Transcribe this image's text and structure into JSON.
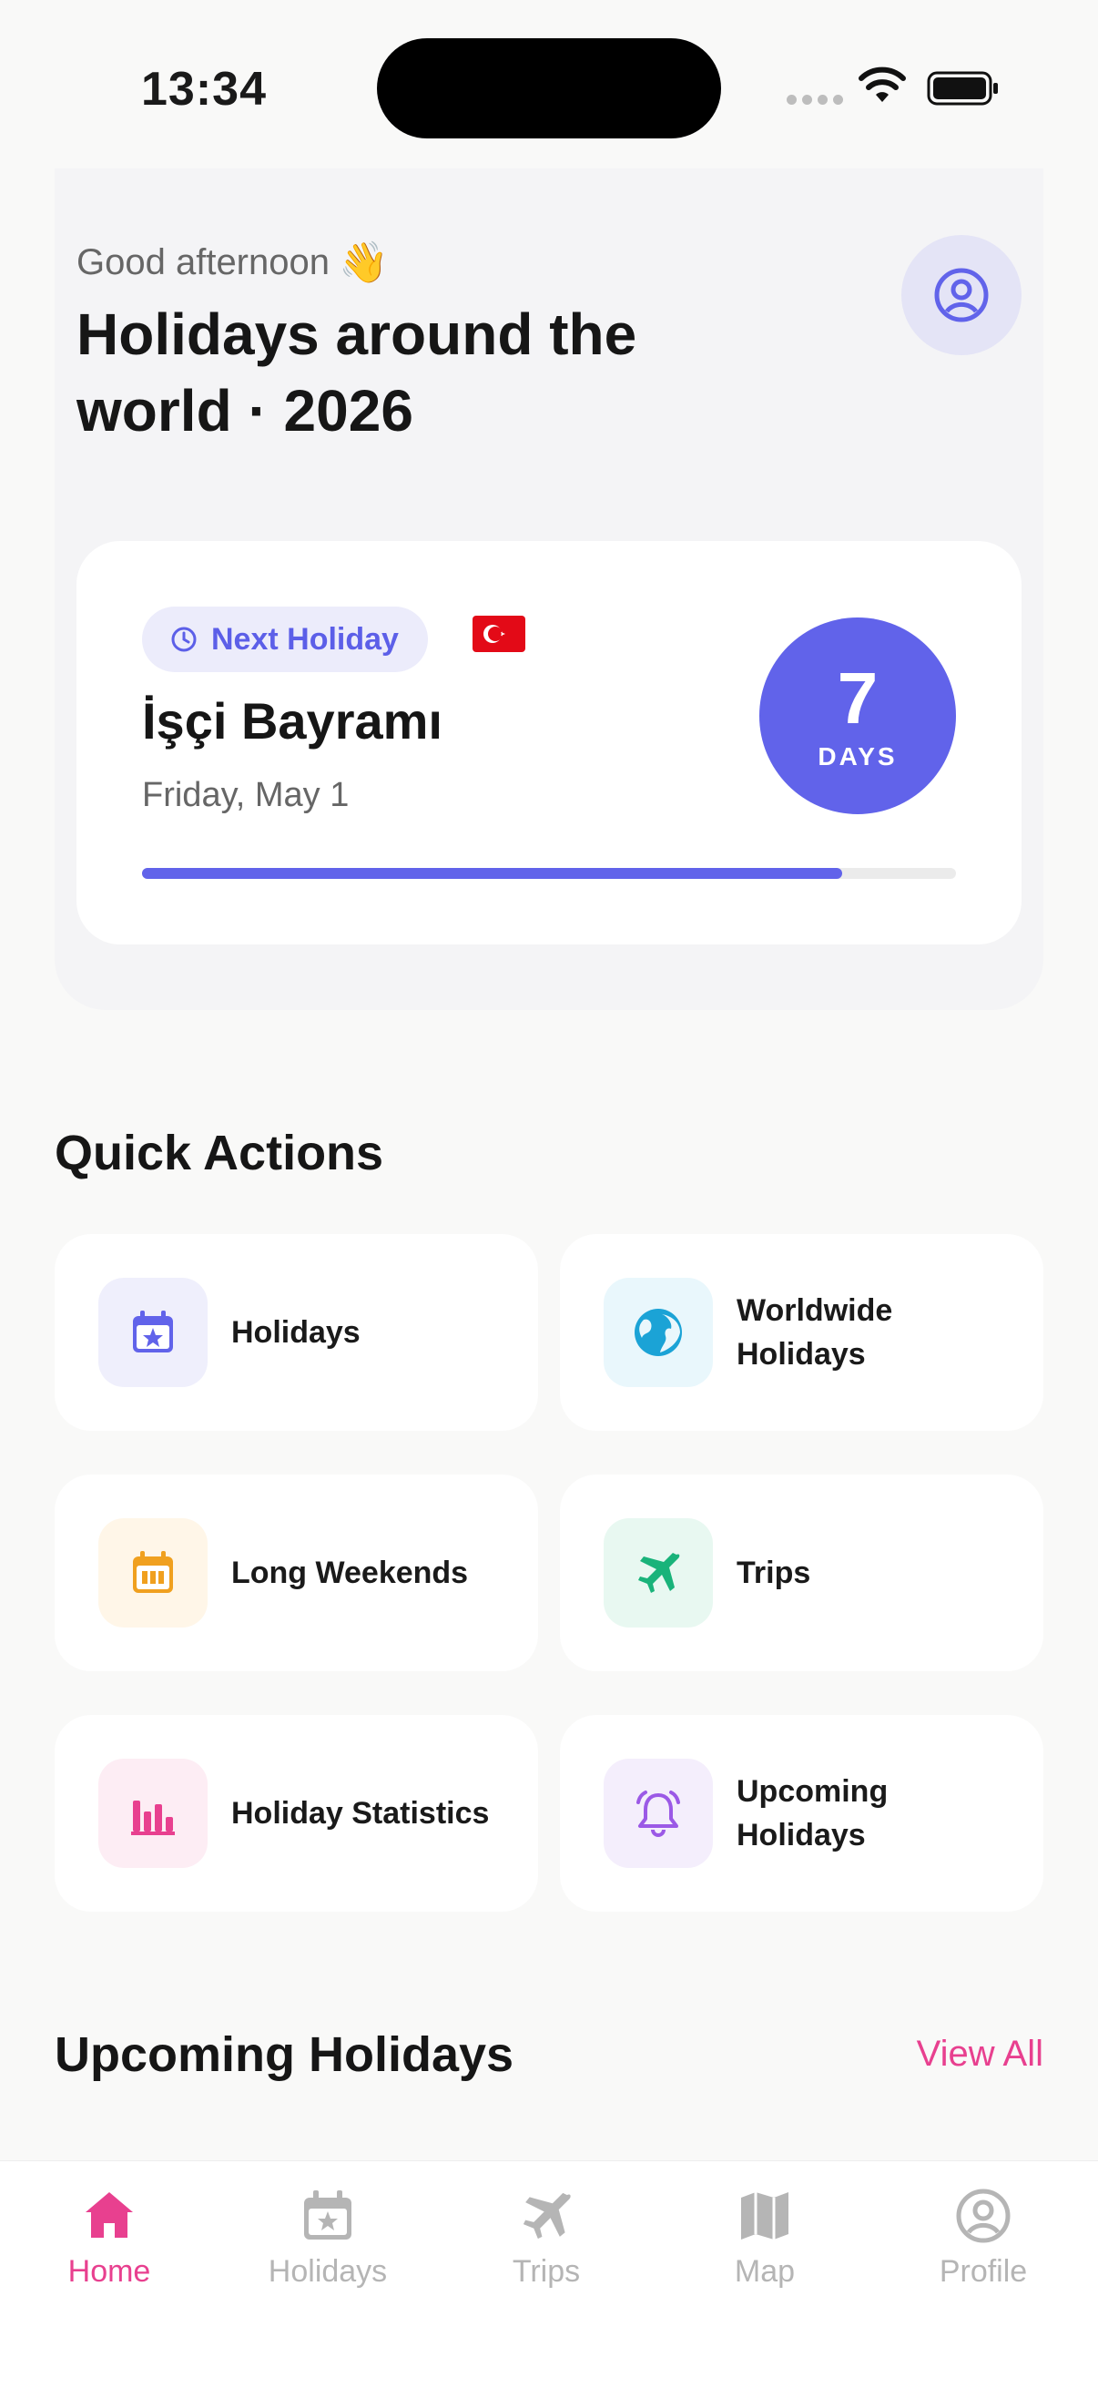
{
  "status_bar": {
    "time": "13:34"
  },
  "header": {
    "greeting": "Good afternoon",
    "greeting_emoji": "👋",
    "title": "Holidays around the world · 2026"
  },
  "next_holiday": {
    "badge": "Next Holiday",
    "flag": "turkey-flag",
    "name": "İşçi Bayramı",
    "date": "Friday, May 1",
    "days_count": "7",
    "days_label": "DAYS",
    "progress": 0.86,
    "accent": "#6163ea"
  },
  "quick_actions": {
    "title": "Quick Actions",
    "items": [
      {
        "label": "Holidays",
        "icon": "calendar-star-icon",
        "color": "#6163ea",
        "bg": "#efeffc"
      },
      {
        "label": "Worldwide Holidays",
        "icon": "globe-icon",
        "color": "#1ba3d6",
        "bg": "#e9f7fc"
      },
      {
        "label": "Long Weekends",
        "icon": "calendar-icon",
        "color": "#f0a01f",
        "bg": "#fff6e8"
      },
      {
        "label": "Trips",
        "icon": "airplane-icon",
        "color": "#19b37a",
        "bg": "#e8f8f1"
      },
      {
        "label": "Holiday Statistics",
        "icon": "bar-chart-icon",
        "color": "#e8408f",
        "bg": "#fdedf4"
      },
      {
        "label": "Upcoming Holidays",
        "icon": "bell-icon",
        "color": "#9b59e6",
        "bg": "#f4eefc"
      }
    ]
  },
  "upcoming": {
    "title": "Upcoming Holidays",
    "view_all": "View All"
  },
  "tabbar": {
    "items": [
      {
        "label": "Home",
        "icon": "home-icon",
        "active": true
      },
      {
        "label": "Holidays",
        "icon": "calendar-star-icon"
      },
      {
        "label": "Trips",
        "icon": "airplane-icon"
      },
      {
        "label": "Map",
        "icon": "map-icon"
      },
      {
        "label": "Profile",
        "icon": "profile-icon"
      }
    ],
    "active_color": "#e8408f",
    "inactive_color": "#b5b5b5"
  }
}
